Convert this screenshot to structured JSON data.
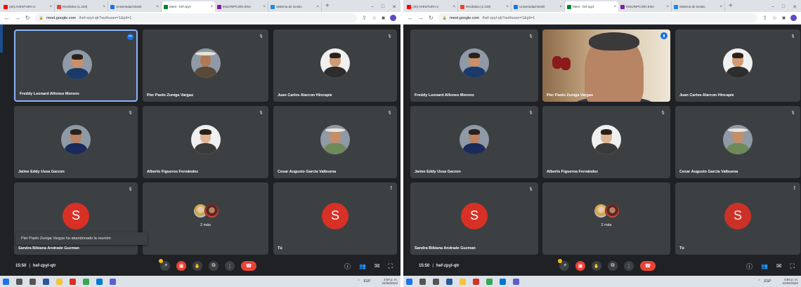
{
  "browser": {
    "tabs": [
      {
        "label": "(40) AVENTURA S",
        "fav": "#ff0000",
        "active": false
      },
      {
        "label": "Recibidos (1.319)",
        "fav": "#ea4335",
        "active": false
      },
      {
        "label": "Universidad Distrit",
        "fav": "#1a73e8",
        "active": false
      },
      {
        "label": "Meet - hef-zpyl-",
        "fav": "#00832d",
        "active": true
      },
      {
        "label": "INSCRIPCIÓN ENA",
        "fav": "#7b1fa2",
        "active": false
      },
      {
        "label": "Sistema de Gestio",
        "fav": "#1e88e5",
        "active": false
      }
    ],
    "new_tab": "+",
    "url_host": "meet.google.com",
    "url_path": "/hef-zpyl-qtr?authuser=1&pli=1",
    "window_controls": [
      "–",
      "□",
      "✕"
    ]
  },
  "left": {
    "participants": [
      {
        "name": "Freddy Leonard Alfonso Moreno",
        "skin": "#c9906b",
        "shirt": "#1b3a6b"
      },
      {
        "name": "Pier Paolo Zuniga Vargas",
        "skin": "#b07a55",
        "shirt": "#5a4a3a"
      },
      {
        "name": "Juan Carlos Alarcon Hincapie",
        "skin": "#d09a72",
        "shirt": "#2d2d2d"
      },
      {
        "name": "Jaime Eddy Ussa Garzon",
        "skin": "#b98263",
        "shirt": "#1a2a5a"
      },
      {
        "name": "Alberto Figueros Fernández",
        "skin": "#e0b394",
        "shirt": "#3a3a3a"
      },
      {
        "name": "Cesar Augusto Garcia Valbuena",
        "skin": "#c48e6a",
        "shirt": "#6e8a5a"
      },
      {
        "name": "Sandra Bibiana Andrade Guzman",
        "letter": "S"
      },
      {
        "name": "",
        "more": "2 más"
      },
      {
        "name": "Tú",
        "letter": "S"
      }
    ],
    "toast": "Pier Paolo Zuniga Vargas ha abandonado la reunión"
  },
  "right": {
    "participants": [
      {
        "name": "Freddy Leonard Alfonso Moreno"
      },
      {
        "name": "Pier Paolo Zuniga Vargas",
        "video": true
      },
      {
        "name": "Juan Carlos Alarcon Hincapie"
      },
      {
        "name": "Jaime Eddy Ussa Garzon"
      },
      {
        "name": "Alberto Figueroa Fernández"
      },
      {
        "name": "Cesar Augusto Garcia Valbuena"
      },
      {
        "name": "Sandra Bibiana Andrade Guzman",
        "letter": "S"
      },
      {
        "name": "",
        "more": "2 más"
      },
      {
        "name": "Tú",
        "letter": "S"
      }
    ]
  },
  "meeting": {
    "time": "15:50",
    "separator": "|",
    "code": "hef-zpyl-qtr"
  },
  "taskbar": {
    "left_clock_time": "3:50 p. m.",
    "left_clock_date": "22/06/2022",
    "right_clock_time": "3:50 p. m.",
    "right_clock_date": "22/06/2022",
    "lang": "ESP"
  },
  "colors": {
    "meet_bg": "#202124",
    "tile_bg": "#3c4043",
    "hangup": "#ea4335",
    "speaking_outline": "#8ab4f8",
    "avatar_letter_bg": "#d93025"
  }
}
